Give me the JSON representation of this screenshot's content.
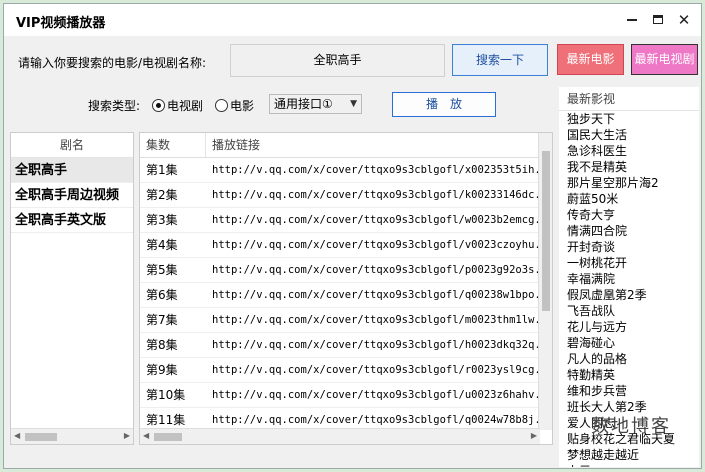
{
  "window": {
    "title": "VIP视频播放器"
  },
  "search": {
    "label": "请输入你要搜索的电影/电视剧名称:",
    "value": "全职高手",
    "search_button": "搜索一下",
    "new_movie_button": "最新电影",
    "new_tv_button": "最新电视剧"
  },
  "options": {
    "type_label": "搜索类型:",
    "radio_tv": "电视剧",
    "radio_movie": "电影",
    "interface": "通用接口①",
    "play_button": "播　放"
  },
  "dramas": {
    "header": "剧名",
    "items": [
      "全职高手",
      "全职高手周边视频",
      "全职高手英文版"
    ]
  },
  "episodes": {
    "headers": [
      "集数",
      "播放链接"
    ],
    "rows": [
      [
        "第1集",
        "http://v.qq.com/x/cover/ttqxo9s3cblgofl/x002353t5ih..."
      ],
      [
        "第2集",
        "http://v.qq.com/x/cover/ttqxo9s3cblgofl/k00233146dc..."
      ],
      [
        "第3集",
        "http://v.qq.com/x/cover/ttqxo9s3cblgofl/w0023b2emcg..."
      ],
      [
        "第4集",
        "http://v.qq.com/x/cover/ttqxo9s3cblgofl/v0023czoyhu..."
      ],
      [
        "第5集",
        "http://v.qq.com/x/cover/ttqxo9s3cblgofl/p0023g92o3s..."
      ],
      [
        "第6集",
        "http://v.qq.com/x/cover/ttqxo9s3cblgofl/q00238w1bpo..."
      ],
      [
        "第7集",
        "http://v.qq.com/x/cover/ttqxo9s3cblgofl/m0023thm1lw..."
      ],
      [
        "第8集",
        "http://v.qq.com/x/cover/ttqxo9s3cblgofl/h0023dkq32q..."
      ],
      [
        "第9集",
        "http://v.qq.com/x/cover/ttqxo9s3cblgofl/r0023ysl9cg..."
      ],
      [
        "第10集",
        "http://v.qq.com/x/cover/ttqxo9s3cblgofl/u0023z6hahv..."
      ],
      [
        "第11集",
        "http://v.qq.com/x/cover/ttqxo9s3cblgofl/q0024w78b8j..."
      ]
    ]
  },
  "latest": {
    "header": "最新影视",
    "items": [
      "独步天下",
      "国民大生活",
      "急诊科医生",
      "我不是精英",
      "那片星空那片海2",
      "蔚蓝50米",
      "传奇大亨",
      "情满四合院",
      "开封奇谈",
      "一树桃花开",
      "幸福满院",
      "假凤虚凰第2季",
      "飞吾战队",
      "花儿与远方",
      "碧海碰心",
      "凡人的品格",
      "特勤精英",
      "维和步兵营",
      "班长大人第2季",
      "爱人同志",
      "贴身校花之君临天夏",
      "梦想越走越近",
      "上元"
    ]
  },
  "watermark": "数地博客"
}
